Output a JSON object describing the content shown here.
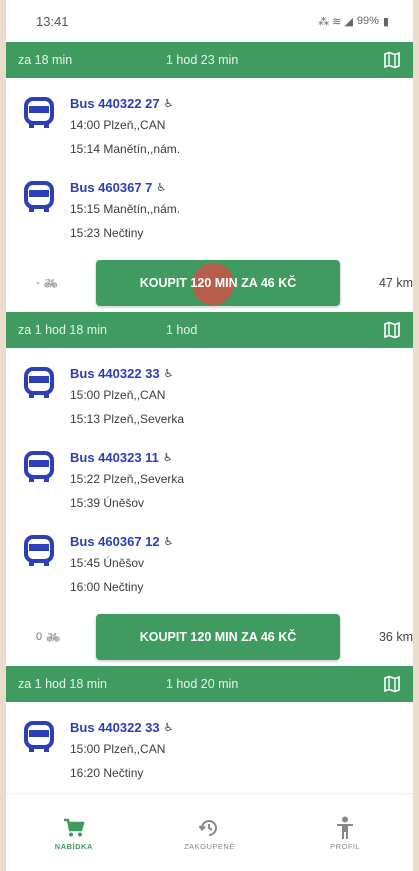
{
  "status_bar": {
    "time": "13:41",
    "battery": "99%"
  },
  "routes": [
    {
      "wait": "za 18 min",
      "duration": "1 hod 23 min",
      "legs": [
        {
          "line": "Bus 440322 27",
          "stops": [
            "14:00 Plzeň,,CAN",
            "15:14 Manětín,,nám."
          ]
        },
        {
          "line": "Bus 460367 7",
          "stops": [
            "15:15 Manětín,,nám.",
            "15:23 Nečtiny"
          ]
        }
      ],
      "bikes": "-",
      "buy_label": "KOUPIT 120 MIN ZA 46 KČ",
      "distance": "47 km"
    },
    {
      "wait": "za 1 hod 18 min",
      "duration": "1 hod",
      "legs": [
        {
          "line": "Bus 440322 33",
          "stops": [
            "15:00 Plzeň,,CAN",
            "15:13 Plzeň,,Severka"
          ]
        },
        {
          "line": "Bus 440323 11",
          "stops": [
            "15:22 Plzeň,,Severka",
            "15:39 Úněšov"
          ]
        },
        {
          "line": "Bus 460367 12",
          "stops": [
            "15:45 Úněšov",
            "16:00 Nečtiny"
          ]
        }
      ],
      "bikes": "0",
      "buy_label": "KOUPIT 120 MIN ZA 46 KČ",
      "distance": "36 km"
    },
    {
      "wait": "za 1 hod 18 min",
      "duration": "1 hod 20 min",
      "legs": [
        {
          "line": "Bus 440322 33",
          "stops": [
            "15:00 Plzeň,,CAN",
            "16:20 Nečtiny"
          ]
        }
      ]
    }
  ],
  "nav": {
    "offer": "NABÍDKA",
    "purchased": "ZAKOUPENÉ",
    "profile": "PROFIL"
  },
  "colors": {
    "accent": "#3f9b5f",
    "bus_line": "#2c3fb8",
    "ripple": "#cc5448"
  },
  "icons": [
    "bus-icon",
    "wheelchair-icon",
    "bike-icon",
    "map-icon",
    "cart-icon",
    "history-icon",
    "person-icon"
  ]
}
